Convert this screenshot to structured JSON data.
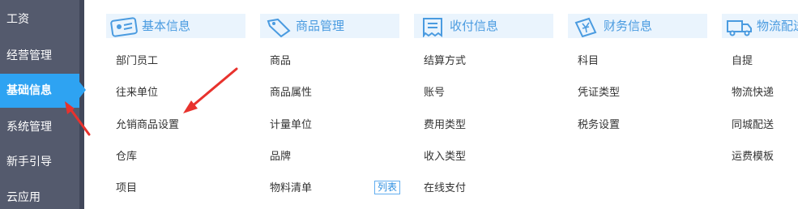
{
  "sidebar": {
    "items": [
      {
        "label": "工资"
      },
      {
        "label": "经营管理"
      },
      {
        "label": "基础信息",
        "active": true
      },
      {
        "label": "系统管理"
      },
      {
        "label": "新手引导"
      },
      {
        "label": "云应用"
      }
    ]
  },
  "columns": [
    {
      "title": "基本信息",
      "icon": "id-card-icon",
      "items": [
        "部门员工",
        "往来单位",
        "允销商品设置",
        "仓库",
        "项目"
      ]
    },
    {
      "title": "商品管理",
      "icon": "price-tag-icon",
      "items": [
        "商品",
        "商品属性",
        "计量单位",
        "品牌",
        "物料清单"
      ],
      "tag": "列表"
    },
    {
      "title": "收付信息",
      "icon": "receipt-icon",
      "items": [
        "结算方式",
        "账号",
        "费用类型",
        "收入类型",
        "在线支付"
      ]
    },
    {
      "title": "财务信息",
      "icon": "yen-document-icon",
      "items": [
        "科目",
        "凭证类型",
        "税务设置"
      ]
    },
    {
      "title": "物流配送",
      "icon": "truck-icon",
      "items": [
        "自提",
        "物流快递",
        "同城配送",
        "运费模板"
      ]
    }
  ],
  "colors": {
    "sidebar_bg": "#545a6d",
    "active_bg": "#2ea3f2",
    "header_bg": "#eaf4fd",
    "header_text": "#4a9be0",
    "annotation_arrow": "#e8322d"
  }
}
